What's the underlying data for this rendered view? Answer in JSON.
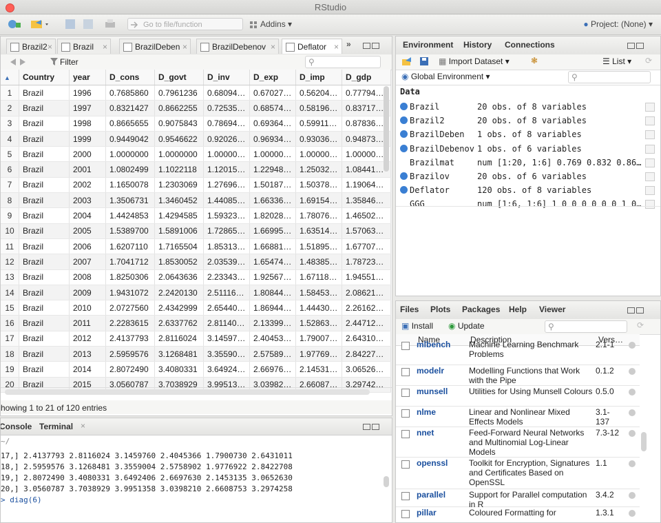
{
  "app": {
    "title": "RStudio",
    "project_label": "Project: (None)"
  },
  "toolbar": {
    "goto_placeholder": "Go to file/function",
    "addins_label": "Addins"
  },
  "source": {
    "tabs": [
      "Brazil2",
      "Brazil",
      "BrazilDeben",
      "BrazilDebenov",
      "Deflator"
    ],
    "filter_label": "Filter",
    "columns": [
      "",
      "Country",
      "year",
      "D_cons",
      "D_govt",
      "D_inv",
      "D_exp",
      "D_imp",
      "D_gdp"
    ],
    "rows": [
      [
        "1",
        "Brazil",
        "1996",
        "0.7685860",
        "0.7961236",
        "0.68094…",
        "0.67027…",
        "0.56204…",
        "0.77794…"
      ],
      [
        "2",
        "Brazil",
        "1997",
        "0.8321427",
        "0.8662255",
        "0.72535…",
        "0.68574…",
        "0.58196…",
        "0.83717…"
      ],
      [
        "3",
        "Brazil",
        "1998",
        "0.8665655",
        "0.9075843",
        "0.78694…",
        "0.69364…",
        "0.59911…",
        "0.87836…"
      ],
      [
        "4",
        "Brazil",
        "1999",
        "0.9449042",
        "0.9546622",
        "0.92026…",
        "0.96934…",
        "0.93036…",
        "0.94873…"
      ],
      [
        "5",
        "Brazil",
        "2000",
        "1.0000000",
        "1.0000000",
        "1.00000…",
        "1.00000…",
        "1.00000…",
        "1.00000…"
      ],
      [
        "6",
        "Brazil",
        "2001",
        "1.0802499",
        "1.1022118",
        "1.12015…",
        "1.22948…",
        "1.25032…",
        "1.08441…"
      ],
      [
        "7",
        "Brazil",
        "2002",
        "1.1650078",
        "1.2303069",
        "1.27696…",
        "1.50187…",
        "1.50378…",
        "1.19064…"
      ],
      [
        "8",
        "Brazil",
        "2003",
        "1.3506731",
        "1.3460452",
        "1.44085…",
        "1.66336…",
        "1.69154…",
        "1.35846…"
      ],
      [
        "9",
        "Brazil",
        "2004",
        "1.4424853",
        "1.4294585",
        "1.59323…",
        "1.82028…",
        "1.78076…",
        "1.46502…"
      ],
      [
        "10",
        "Brazil",
        "2005",
        "1.5389700",
        "1.5891006",
        "1.72865…",
        "1.66995…",
        "1.63514…",
        "1.57063…"
      ],
      [
        "11",
        "Brazil",
        "2006",
        "1.6207110",
        "1.7165504",
        "1.85313…",
        "1.66881…",
        "1.51895…",
        "1.67707…"
      ],
      [
        "12",
        "Brazil",
        "2007",
        "1.7041712",
        "1.8530052",
        "2.03539…",
        "1.65474…",
        "1.48385…",
        "1.78723…"
      ],
      [
        "13",
        "Brazil",
        "2008",
        "1.8250306",
        "2.0643636",
        "2.23343…",
        "1.92567…",
        "1.67118…",
        "1.94551…"
      ],
      [
        "14",
        "Brazil",
        "2009",
        "1.9431072",
        "2.2420130",
        "2.51116…",
        "1.80844…",
        "1.58453…",
        "2.08621…"
      ],
      [
        "15",
        "Brazil",
        "2010",
        "2.0727560",
        "2.4342999",
        "2.65440…",
        "1.86944…",
        "1.44430…",
        "2.26162…"
      ],
      [
        "16",
        "Brazil",
        "2011",
        "2.2283615",
        "2.6337762",
        "2.81140…",
        "2.13399…",
        "1.52863…",
        "2.44712…"
      ],
      [
        "17",
        "Brazil",
        "2012",
        "2.4137793",
        "2.8116024",
        "3.14597…",
        "2.40453…",
        "1.79007…",
        "2.64310…"
      ],
      [
        "18",
        "Brazil",
        "2013",
        "2.5959576",
        "3.1268481",
        "3.35590…",
        "2.57589…",
        "1.97769…",
        "2.84227…"
      ],
      [
        "19",
        "Brazil",
        "2014",
        "2.8072490",
        "3.4080331",
        "3.64924…",
        "2.66976…",
        "2.14531…",
        "3.06526…"
      ],
      [
        "20",
        "Brazil",
        "2015",
        "3.0560787",
        "3.7038929",
        "3.99513…",
        "3.03982…",
        "2.66087…",
        "3.29742…"
      ]
    ],
    "status": "howing 1 to 21 of 120 entries"
  },
  "console": {
    "tabs": [
      "Console",
      "Terminal"
    ],
    "path": "~/",
    "lines": [
      "17,] 2.4137793 2.8116024 3.1459760 2.4045366 1.7900730 2.6431011",
      "18,] 2.5959576 3.1268481 3.3559004 2.5758902 1.9776922 2.8422708",
      "19,] 2.8072490 3.4080331 3.6492406 2.6697630 2.1453135 3.0652630",
      "20,] 3.0560787 3.7038929 3.9951358 3.0398210 2.6608753 3.2974258",
      "> diag(6)"
    ]
  },
  "env": {
    "tabs": [
      "Environment",
      "History",
      "Connections"
    ],
    "import_label": "Import Dataset",
    "list_label": "List",
    "scope_label": "Global Environment",
    "section_label": "Data",
    "items": [
      {
        "name": "Brazil",
        "value": "20 obs. of 8 variables",
        "dot": true
      },
      {
        "name": "Brazil2",
        "value": "20 obs. of 8 variables",
        "dot": true
      },
      {
        "name": "BrazilDeben",
        "value": "1 obs. of 8 variables",
        "dot": true
      },
      {
        "name": "BrazilDebenov",
        "value": "1 obs. of 6 variables",
        "dot": true
      },
      {
        "name": "Brazilmat",
        "value": "num [1:20, 1:6] 0.769 0.832 0.86…",
        "dot": false
      },
      {
        "name": "Brazilov",
        "value": "20 obs. of 6 variables",
        "dot": true
      },
      {
        "name": "Deflator",
        "value": "120 obs. of 8 variables",
        "dot": true
      },
      {
        "name": "GGG",
        "value": "num [1:6, 1:6] 1 0 0 0 0 0 0 1 0…",
        "dot": false
      }
    ]
  },
  "files": {
    "tabs": [
      "Files",
      "Plots",
      "Packages",
      "Help",
      "Viewer"
    ],
    "install_label": "Install",
    "update_label": "Update",
    "headers": [
      "Name",
      "Description",
      "Vers…"
    ],
    "packages": [
      {
        "name": "mlbench",
        "desc": "Machine Learning Benchmark Problems",
        "ver": "2.1-1"
      },
      {
        "name": "modelr",
        "desc": "Modelling Functions that Work with the Pipe",
        "ver": "0.1.2"
      },
      {
        "name": "munsell",
        "desc": "Utilities for Using Munsell Colours",
        "ver": "0.5.0"
      },
      {
        "name": "nlme",
        "desc": "Linear and Nonlinear Mixed Effects Models",
        "ver": "3.1-137"
      },
      {
        "name": "nnet",
        "desc": "Feed-Forward Neural Networks and Multinomial Log-Linear Models",
        "ver": "7.3-12"
      },
      {
        "name": "openssl",
        "desc": "Toolkit for Encryption, Signatures and Certificates Based on OpenSSL",
        "ver": "1.1"
      },
      {
        "name": "parallel",
        "desc": "Support for Parallel computation in R",
        "ver": "3.4.2"
      },
      {
        "name": "pillar",
        "desc": "Coloured Formatting for",
        "ver": "1.3.1"
      }
    ]
  }
}
